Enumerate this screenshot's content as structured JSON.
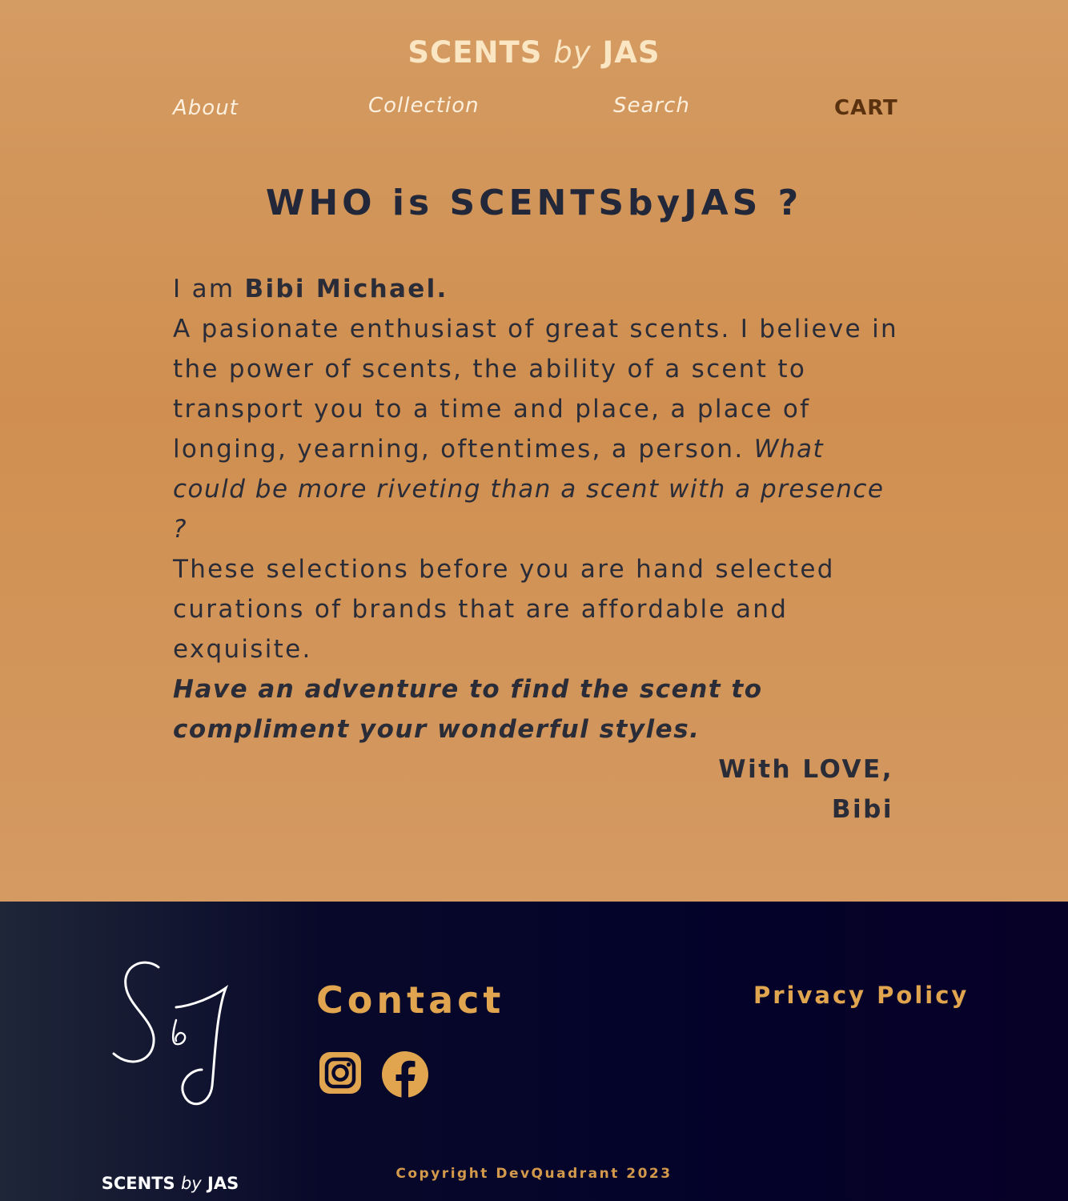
{
  "header": {
    "brand_left": "SCENTS",
    "brand_by": "by",
    "brand_right": "JAS"
  },
  "nav": {
    "about": "About",
    "collection": "Collection",
    "search": "Search",
    "cart": "CART"
  },
  "main": {
    "heading": "WHO is SCENTSbyJAS ?",
    "intro_prefix": "I am ",
    "intro_name": "Bibi Michael.",
    "paragraph_1": "A pasionate enthusiast of great scents. I believe in the power of scents, the ability of a scent to transport you to a time and place, a place of longing, yearning, oftentimes, a person. ",
    "paragraph_1_italic": "What could be more riveting than a scent with a presence ?",
    "paragraph_2": "These selections before you are hand selected curations of brands that are affordable and exquisite.",
    "tagline": "Have an adventure to find the scent to compliment your wonderful styles.",
    "signoff_line1": "With LOVE,",
    "signoff_line2": "Bibi"
  },
  "footer": {
    "logo_monogram": "S&J",
    "logo_left": "SCENTS",
    "logo_by": "by",
    "logo_right": "JAS",
    "contact_heading": "Contact",
    "social_icons": [
      "instagram-icon",
      "facebook-icon"
    ],
    "privacy_link": "Privacy Policy",
    "copyright": "Copyright DevQuadrant 2023"
  },
  "colors": {
    "page_background": "#d49a5e",
    "footer_background": "#04032a",
    "accent_gold": "#e0a54e",
    "heading_text": "#22283a",
    "cart_text": "#5a320f",
    "brand_cream": "#fbe6c4"
  }
}
